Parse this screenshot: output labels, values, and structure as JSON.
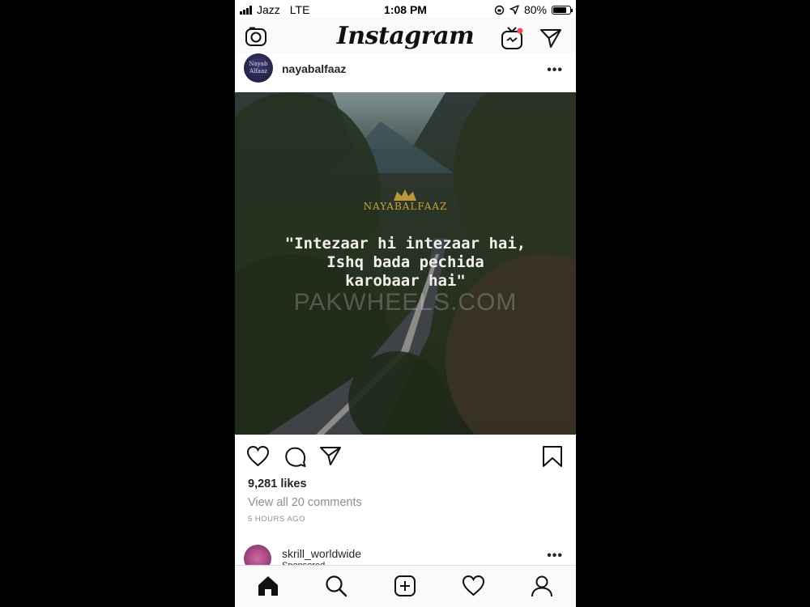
{
  "status_bar": {
    "carrier": "Jazz",
    "network": "LTE",
    "time": "1:08 PM",
    "battery": "80%",
    "battery_level": 0.8
  },
  "top_nav": {
    "logo": "Instagram",
    "icons": [
      "camera-icon",
      "igtv-icon",
      "direct-message-icon"
    ]
  },
  "post": {
    "avatar_text": [
      "Nayab",
      "Alfaaz"
    ],
    "username": "nayabalfaaz",
    "image": {
      "brand": "NAYABALFAAZ",
      "quote_lines": [
        "\"Intezaar hi intezaar hai,",
        "Ishq bada pechida",
        "karobaar hai\""
      ],
      "watermark": "PAKWHEELS.COM"
    },
    "actions": [
      "heart-icon",
      "comment-icon",
      "share-icon",
      "bookmark-icon"
    ],
    "likes": "9,281 likes",
    "view_comments": "View all 20 comments",
    "time_ago": "5 HOURS AGO"
  },
  "next_post": {
    "username": "skrill_worldwide",
    "label": "Sponsored"
  },
  "bottom_nav": [
    "home-icon",
    "search-icon",
    "new-post-icon",
    "activity-icon",
    "profile-icon"
  ]
}
